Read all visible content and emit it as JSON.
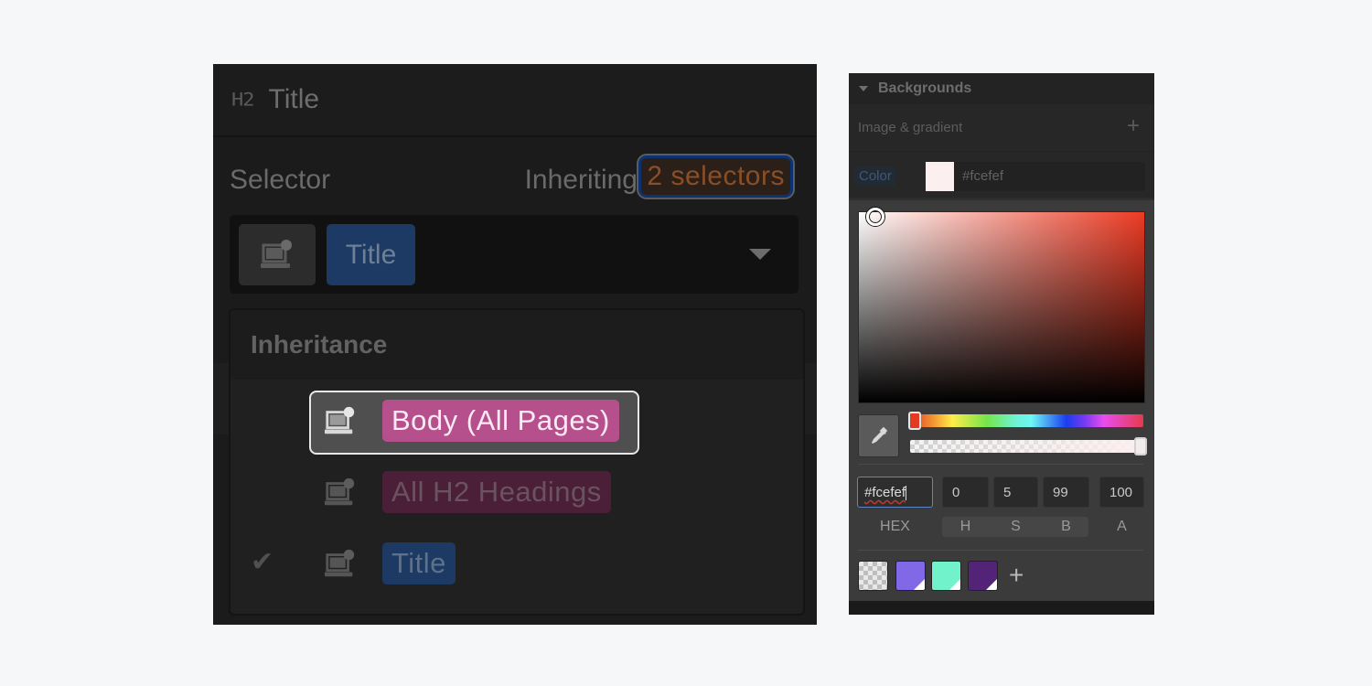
{
  "left_panel": {
    "header": {
      "tag_icon": "H2",
      "title": "Title"
    },
    "selector_label": "Selector",
    "inheriting_label": "Inheriting",
    "inheriting_badge": "2 selectors",
    "selector_field": {
      "device_icon": "device-icon",
      "chip": "Title"
    },
    "inheritance": {
      "title": "Inheritance",
      "items": [
        {
          "label": "Body (All Pages)",
          "highlighted": true,
          "checked": false,
          "chip_color": "#b5508d"
        },
        {
          "label": "All H2 Headings",
          "highlighted": false,
          "checked": false,
          "chip_color": "#4a1f37"
        },
        {
          "label": "Title",
          "highlighted": false,
          "checked": true,
          "chip_color": "#1c3a63"
        }
      ]
    }
  },
  "right_panel": {
    "section_title": "Backgrounds",
    "image_gradient_label": "Image & gradient",
    "color_label": "Color",
    "color_value": "#fcefef",
    "picker": {
      "hex": "#fcefef",
      "h": "0",
      "s": "5",
      "b": "99",
      "a": "100",
      "labels": {
        "hex": "HEX",
        "h": "H",
        "s": "S",
        "b": "B",
        "a": "A"
      },
      "hue_percent": 0,
      "alpha_percent": 100
    },
    "presets": [
      "transparent",
      "#8068e6",
      "#72f2ca",
      "#532378"
    ],
    "add_preset_label": "+"
  },
  "colors": {
    "page_bg": "#f6f7f9",
    "accent_blue": "#5c86c4",
    "badge_orange": "#8a4f24"
  }
}
